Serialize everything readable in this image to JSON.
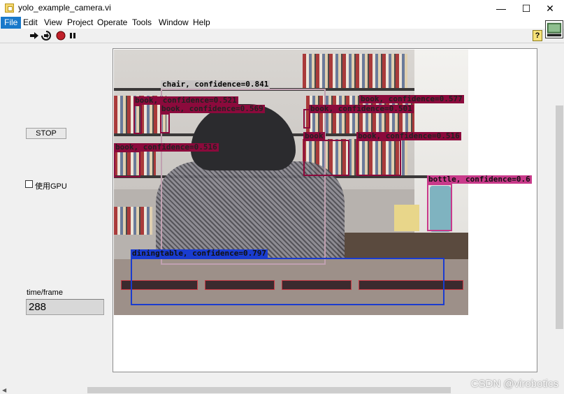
{
  "window": {
    "title": "yolo_example_camera.vi",
    "minimize": "—",
    "maximize": "☐",
    "close": "✕"
  },
  "menu": {
    "items": [
      "File",
      "Edit",
      "View",
      "Project",
      "Operate",
      "Tools",
      "Window",
      "Help"
    ],
    "active": "File"
  },
  "toolbar": {
    "run_icon": "run-arrow-icon",
    "continuous_icon": "run-continuously-icon",
    "abort_icon": "abort-icon",
    "pause_icon": "pause-icon",
    "help_label": "?"
  },
  "panel": {
    "stop_label": "STOP",
    "gpu_label": "使用GPU",
    "gpu_checked": false,
    "time_label": "time/frame",
    "time_value": "288"
  },
  "detections": [
    {
      "label": "chair, confidence=0.841",
      "color": "#b07090"
    },
    {
      "label": "book, confidence=0.521",
      "color": "#8b0a3c"
    },
    {
      "label": "book, confidence=0.569",
      "color": "#8b0a3c"
    },
    {
      "label": "book, confidence=0.516",
      "color": "#8b0a3c"
    },
    {
      "label": "book, confidence=0.501",
      "color": "#8b0a3c"
    },
    {
      "label": "book, confidence=0.577",
      "color": "#8b0a3c"
    },
    {
      "label": "book",
      "color": "#8b0a3c"
    },
    {
      "label": "book, confidence=0.516",
      "color": "#8b0a3c"
    },
    {
      "label": "bottle, confidence=0.6",
      "color": "#c83a8a"
    },
    {
      "label": "diningtable, confidence=0.797",
      "color": "#1a3ccf"
    }
  ],
  "watermark": "CSDN @virobotics"
}
